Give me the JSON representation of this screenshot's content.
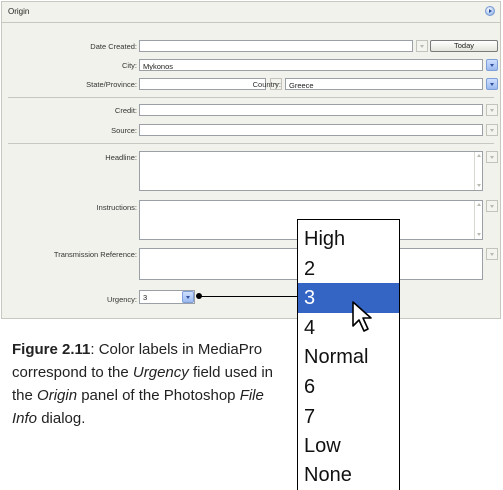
{
  "panel": {
    "title": "Origin"
  },
  "fields": {
    "date_created": {
      "label": "Date Created:",
      "value": ""
    },
    "today_button": "Today",
    "city": {
      "label": "City:",
      "value": "Mykonos"
    },
    "state": {
      "label": "State/Province:",
      "value": ""
    },
    "country": {
      "label": "Country:",
      "value": "Greece"
    },
    "credit": {
      "label": "Credit:",
      "value": ""
    },
    "source": {
      "label": "Source:",
      "value": ""
    },
    "headline": {
      "label": "Headline:",
      "value": ""
    },
    "instructions": {
      "label": "Instructions:",
      "value": ""
    },
    "transmission": {
      "label": "Transmission Reference:",
      "value": ""
    },
    "urgency": {
      "label": "Urgency:",
      "value": "3"
    }
  },
  "urgency_options": [
    "High",
    "2",
    "3",
    "4",
    "Normal",
    "6",
    "7",
    "Low",
    "None"
  ],
  "urgency_selected": "3",
  "caption": {
    "figure": "Figure 2.11",
    "p1": ": Color labels in MediaPro correspond to the ",
    "urgency": "Urgency",
    "p2": " field used in the ",
    "origin": "Origin",
    "p3": " panel of the Photoshop ",
    "fileinfo": "File Info",
    "p4": " dialog."
  },
  "colors": {
    "selection": "#3465c5",
    "panel_bg": "#f2f2ec",
    "accent_button": "#9bb9f0"
  },
  "icons": [
    "collapse-icon",
    "dropdown-arrow-icon",
    "mouse-cursor-icon"
  ]
}
